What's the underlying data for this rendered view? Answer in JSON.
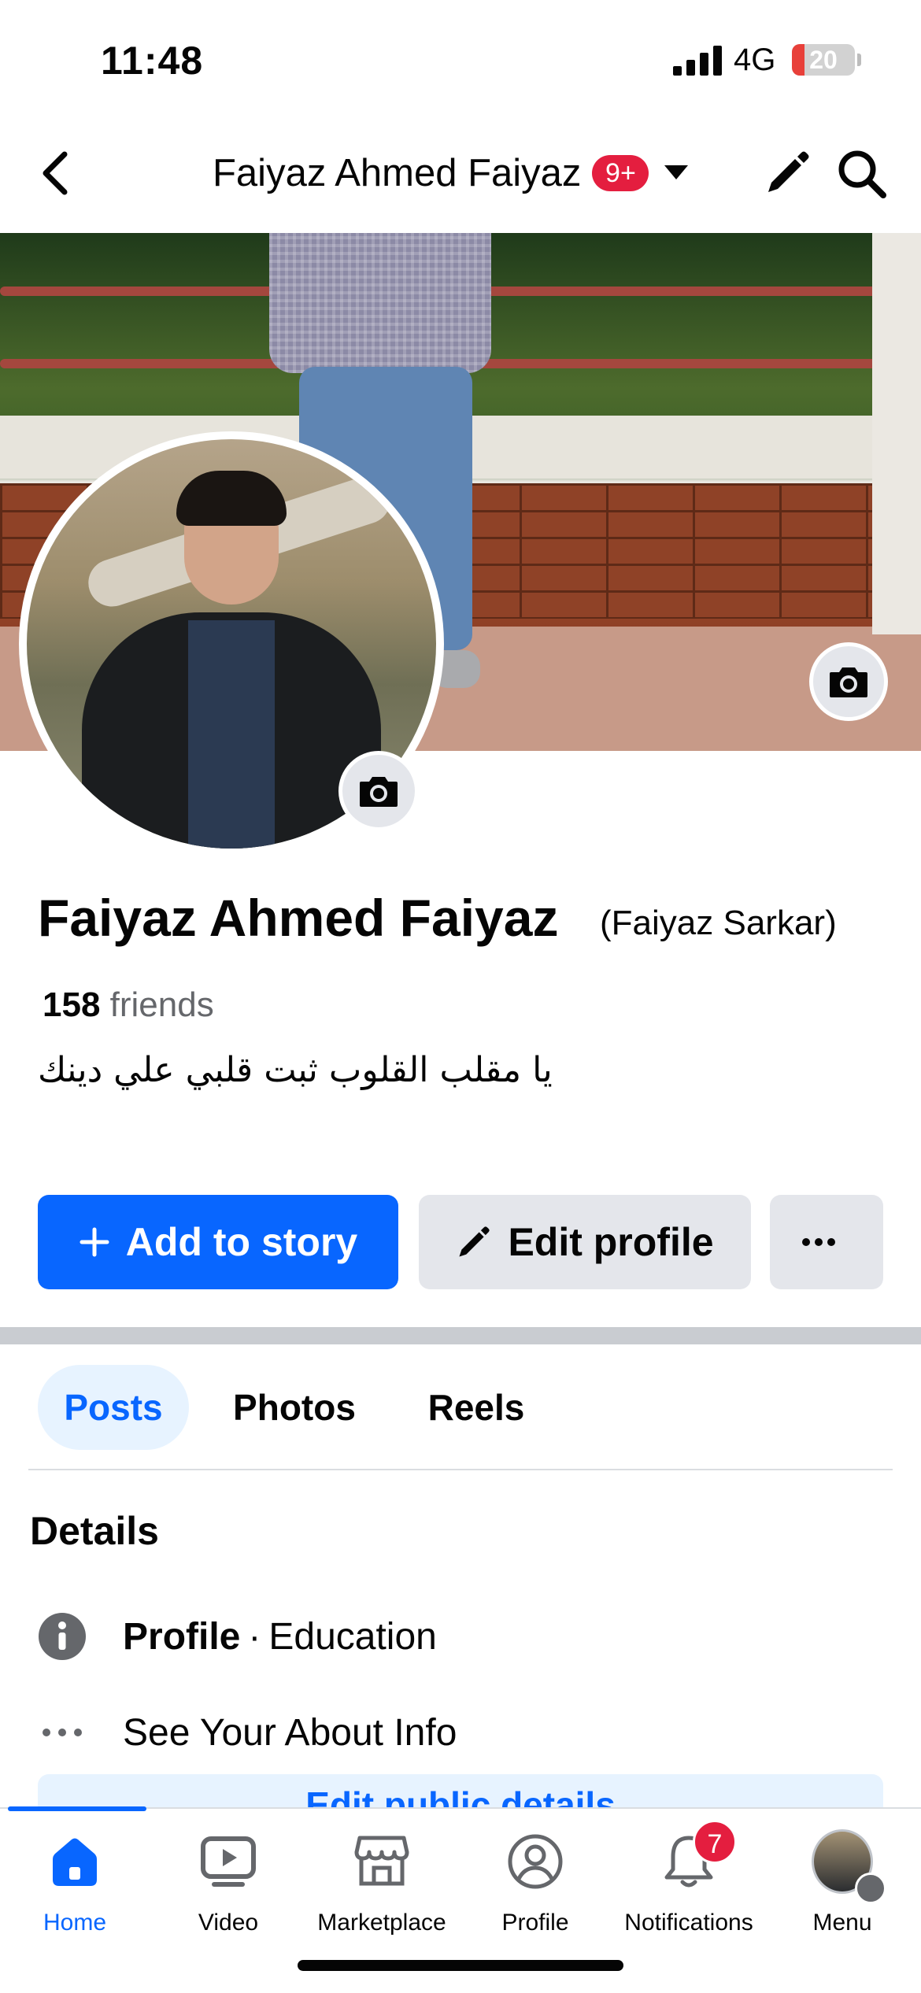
{
  "status_bar": {
    "time": "11:48",
    "network": "4G",
    "battery": "20",
    "battery_level": 0.2
  },
  "top_nav": {
    "title": "Faiyaz Ahmed Faiyaz",
    "badge": "9+"
  },
  "profile": {
    "name": "Faiyaz Ahmed Faiyaz",
    "alternate_name": "(Faiyaz Sarkar)",
    "friends_count": "158",
    "friends_label": "friends",
    "bio": "يا مقلب القلوب ثبت قلبي علي دينك"
  },
  "actions": {
    "add_story": "Add to story",
    "edit_profile": "Edit profile",
    "more": "···"
  },
  "tabs": [
    {
      "label": "Posts",
      "active": true
    },
    {
      "label": "Photos",
      "active": false
    },
    {
      "label": "Reels",
      "active": false
    }
  ],
  "details": {
    "heading": "Details",
    "profile_label": "Profile",
    "separator": "·",
    "profile_value": "Education",
    "about_link": "See Your About Info",
    "edit_button": "Edit public details"
  },
  "bottom_nav": {
    "items": [
      {
        "label": "Home",
        "icon": "home-icon",
        "active": true
      },
      {
        "label": "Video",
        "icon": "video-icon",
        "active": false
      },
      {
        "label": "Marketplace",
        "icon": "marketplace-icon",
        "active": false
      },
      {
        "label": "Profile",
        "icon": "profile-icon",
        "active": false
      },
      {
        "label": "Notifications",
        "icon": "bell-icon",
        "active": false,
        "badge": "7"
      },
      {
        "label": "Menu",
        "icon": "menu-avatar",
        "active": false
      }
    ]
  },
  "colors": {
    "accent": "#0866ff",
    "badge": "#e41e3f",
    "button_grey": "#e4e6eb",
    "secondary_text": "#65676b"
  }
}
